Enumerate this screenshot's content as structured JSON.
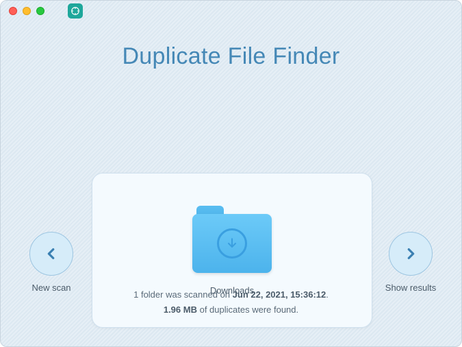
{
  "app": {
    "title": "Duplicate File Finder"
  },
  "nav": {
    "prev_label": "New scan",
    "next_label": "Show results"
  },
  "card": {
    "folder_name": "Downloads"
  },
  "status": {
    "line1_prefix": "1 folder was scanned on ",
    "line1_bold": "Jun 22, 2021, 15:36:12",
    "line1_suffix": ".",
    "line2_bold": "1.96 MB",
    "line2_suffix": " of duplicates were found."
  },
  "colors": {
    "accent": "#4588b6"
  }
}
